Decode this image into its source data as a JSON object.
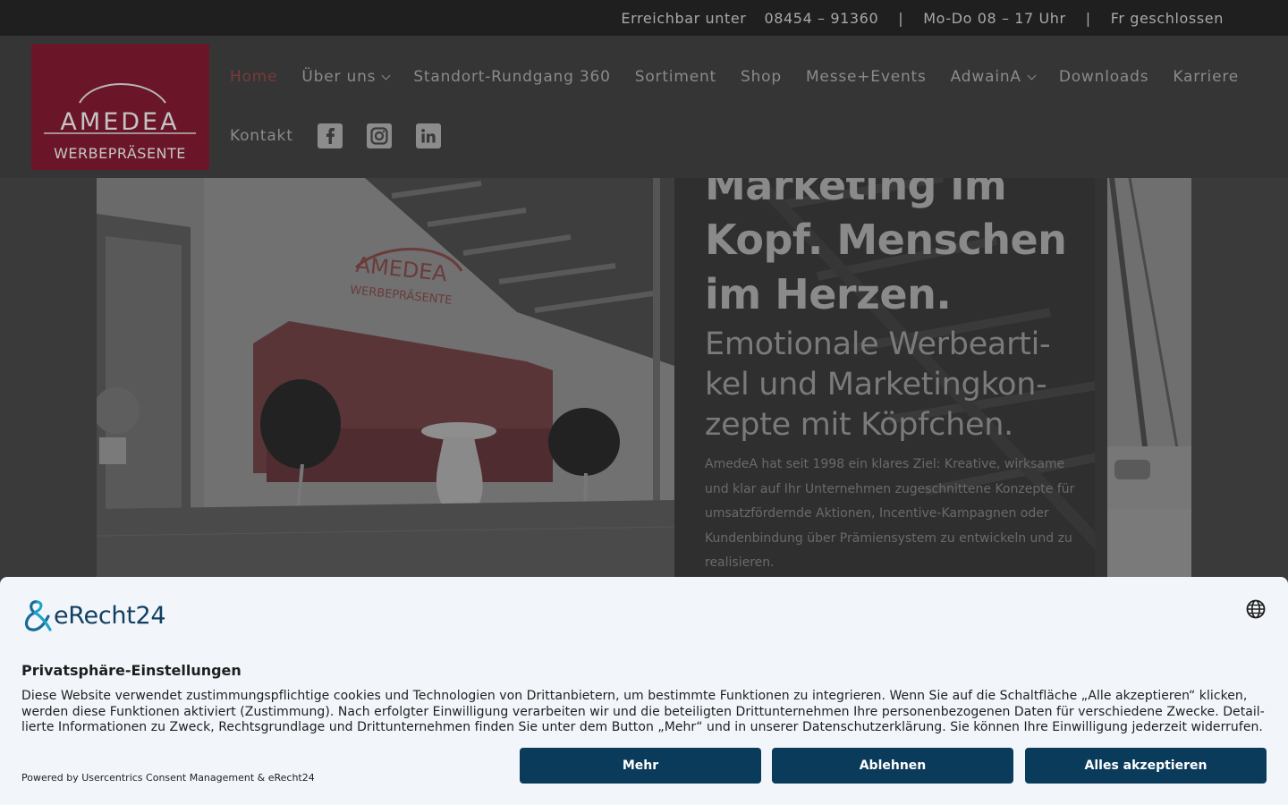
{
  "topbar": {
    "reach_label": "Erreichbar unter",
    "phone": "08454 – 91360",
    "separator": "|",
    "hours": "Mo-Do 08 – 17 Uhr",
    "friday": "Fr geschlossen"
  },
  "logo": {
    "line1": "AMEDEA",
    "line2": "WERBEPRÄSENTE"
  },
  "nav": {
    "items": [
      {
        "label": "Home"
      },
      {
        "label": "Über uns"
      },
      {
        "label": "Standort-Rundgang 360"
      },
      {
        "label": "Sortiment"
      },
      {
        "label": "Shop"
      },
      {
        "label": "Messe+Events"
      },
      {
        "label": "AdwainA"
      },
      {
        "label": "Downloads"
      },
      {
        "label": "Karriere"
      },
      {
        "label": "Kontakt"
      }
    ],
    "social_icons": [
      "facebook-icon",
      "instagram-icon",
      "linkedin-icon"
    ]
  },
  "hero": {
    "headline": "Marketing im Kopf. Menschen im Herzen.",
    "subheadline": "Emotionale Werbearti­kel und Marketingkon­zepte mit Köpfchen.",
    "body": "AmedeA hat seit 1998 ein klares Ziel: Kreative, wirksame und klar auf Ihr Unternehmen zugeschnittene Konzepte für umsatzfördernde Aktionen, Incentive-Kampagnen oder Kundenbindung über Prämiensystem zu entwickeln und zu realisieren."
  },
  "cookie": {
    "brand": "eRecht24",
    "title": "Privatsphäre-Einstellungen",
    "description": "Diese Website verwendet zustimmungspflichtige cookies und Technologien von Drittanbietern, um bestimmte Funktionen zu integrieren. Wenn Sie auf die Schaltfläche „Alle akzeptieren“ klicken, werden diese Funktionen aktiviert (Zustimmung). Nach erfolgter Einwilligung verarbeiten wir und die beteiligten Drittunternehmen Ihre personenbezogenen Daten für verschiedene Zwecke. Detail­lierte Informationen zu Zweck, Rechtsgrundlage und Drittunternehmen finden Sie unter dem Button „Mehr“ und in unserer Datenschutzerklärung. Sie können Ihre Einwilligung jederzeit widerrufen.",
    "powered_by": "Powered by Usercentrics Consent Management & eRecht24",
    "buttons": {
      "more": "Mehr",
      "decline": "Ablehnen",
      "accept_all": "Alles akzeptieren"
    },
    "colors": {
      "primary": "#0b3b5a",
      "background": "#f2f6fb"
    }
  }
}
